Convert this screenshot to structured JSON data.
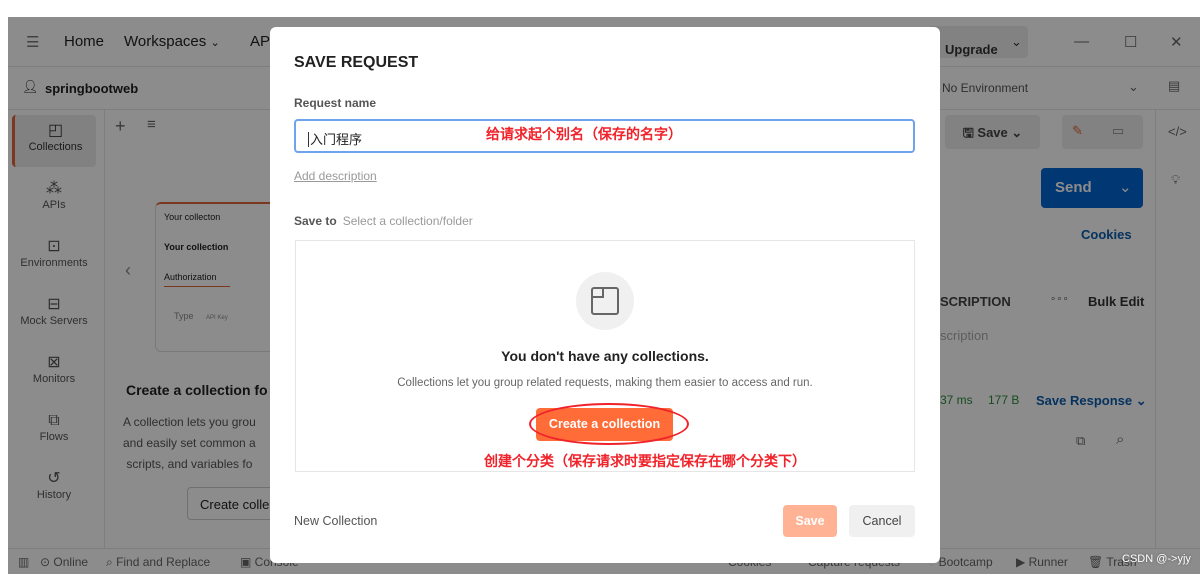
{
  "titlebar": {
    "menu_icon": "hamburger-icon",
    "home": "Home",
    "workspaces": "Workspaces",
    "api": "AP",
    "upgrade": "Upgrade"
  },
  "workspace": {
    "name": "springbootweb",
    "environment": "No Environment"
  },
  "sidebar": {
    "items": [
      {
        "label": "Collections",
        "icon": "collection-icon"
      },
      {
        "label": "APIs",
        "icon": "apis-icon"
      },
      {
        "label": "Environments",
        "icon": "environment-icon"
      },
      {
        "label": "Mock Servers",
        "icon": "server-icon"
      },
      {
        "label": "Monitors",
        "icon": "monitor-icon"
      },
      {
        "label": "Flows",
        "icon": "flows-icon"
      },
      {
        "label": "History",
        "icon": "history-icon"
      }
    ]
  },
  "collections_panel": {
    "preview": {
      "tab": "Your collecton",
      "title": "Your collection",
      "auth": "Authorization",
      "type_label": "Type",
      "type_value": "API Key"
    },
    "heading": "Create a collection fo",
    "body": [
      "A collection lets you grou",
      "and easily set common a",
      "scripts, and variables fo"
    ],
    "create_button": "Create colle"
  },
  "request_panel": {
    "save": "Save",
    "send": "Send",
    "cookies": "Cookies",
    "description_header": "SCRIPTION",
    "bulk_edit": "Bulk Edit",
    "description_placeholder": "scription",
    "time": "37 ms",
    "size": "177 B",
    "save_response": "Save Response"
  },
  "statusbar": {
    "online": "Online",
    "find_replace": "Find and Replace",
    "console": "Console",
    "cookies": "Cookies",
    "capture": "Capture requests",
    "bootcamp": "Bootcamp",
    "runner": "Runner",
    "trash": "Trash"
  },
  "watermark": "CSDN @->yjy",
  "modal": {
    "title": "SAVE REQUEST",
    "request_name_label": "Request name",
    "request_name_value": "入门程序",
    "add_description": "Add description",
    "save_to_label": "Save to",
    "save_to_placeholder": "Select a collection/folder",
    "empty_title": "You don't have any collections.",
    "empty_body": "Collections let you group related requests, making them easier to access and run.",
    "create_collection": "Create a collection",
    "new_collection": "New Collection",
    "save": "Save",
    "cancel": "Cancel"
  },
  "annotations": {
    "name_note": "给请求起个别名（保存的名字）",
    "collection_note": "创建个分类（保存请求时要指定保存在哪个分类下）"
  },
  "colors": {
    "accent": "#ff6c37",
    "send": "#0265d2",
    "annotation": "#f0222a",
    "link": "#0b5cad"
  }
}
